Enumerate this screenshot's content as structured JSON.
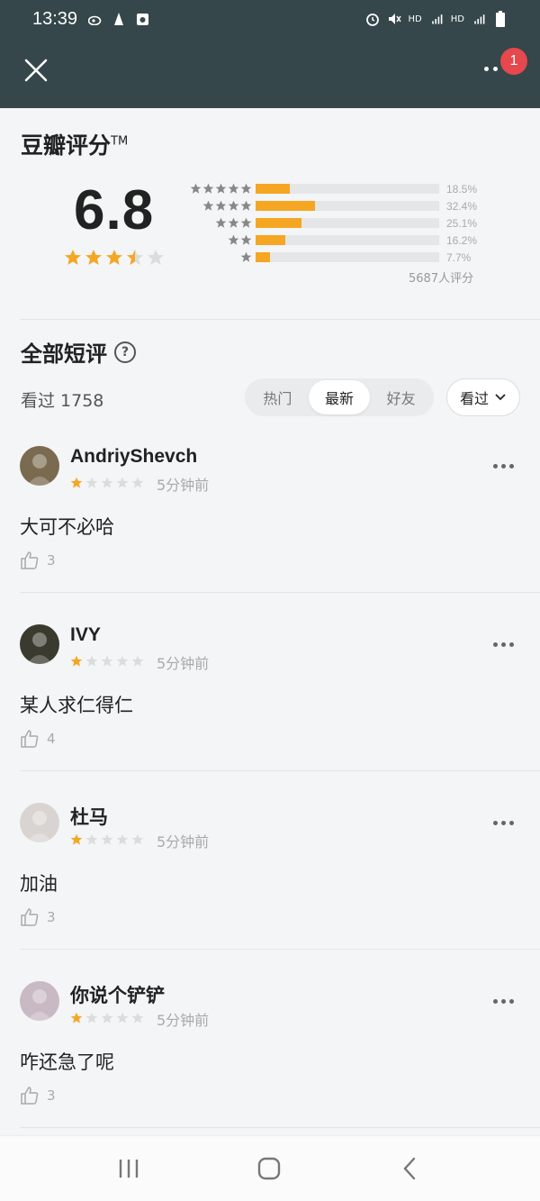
{
  "status_bar": {
    "time": "13:39"
  },
  "top_bar": {
    "notification_count": "1"
  },
  "rating": {
    "heading": "豆瓣评分",
    "trademark": "TM",
    "score": "6.8",
    "score_stars": 3.5,
    "distribution": [
      {
        "stars": 5,
        "percent": "18.5%",
        "value": 18.5
      },
      {
        "stars": 4,
        "percent": "32.4%",
        "value": 32.4
      },
      {
        "stars": 3,
        "percent": "25.1%",
        "value": 25.1
      },
      {
        "stars": 2,
        "percent": "16.2%",
        "value": 16.2
      },
      {
        "stars": 1,
        "percent": "7.7%",
        "value": 7.7
      }
    ],
    "count": "5687人评分"
  },
  "reviews_section": {
    "title": "全部短评",
    "seen": "看过 1758",
    "tabs": [
      "热门",
      "最新",
      "好友"
    ],
    "active_tab": "最新",
    "filter": "看过"
  },
  "comments": [
    {
      "name": "AndriyShevch",
      "rating": 1,
      "time": "5分钟前",
      "text": "大可不必哈",
      "likes": "3",
      "avatar_color": "#7a6a4f"
    },
    {
      "name": "IVY",
      "rating": 1,
      "time": "5分钟前",
      "text": "某人求仁得仁",
      "likes": "4",
      "avatar_color": "#3b3a2e"
    },
    {
      "name": "杜马",
      "rating": 1,
      "time": "5分钟前",
      "text": "加油",
      "likes": "3",
      "avatar_color": "#d9d4d2"
    },
    {
      "name": "你说个铲铲",
      "rating": 1,
      "time": "5分钟前",
      "text": "咋还急了呢",
      "likes": "3",
      "avatar_color": "#c9b9c4"
    }
  ],
  "colors": {
    "header": "#35474a",
    "star": "#f5a623",
    "star_empty": "#dcdcdc",
    "badge": "#e5484d"
  }
}
